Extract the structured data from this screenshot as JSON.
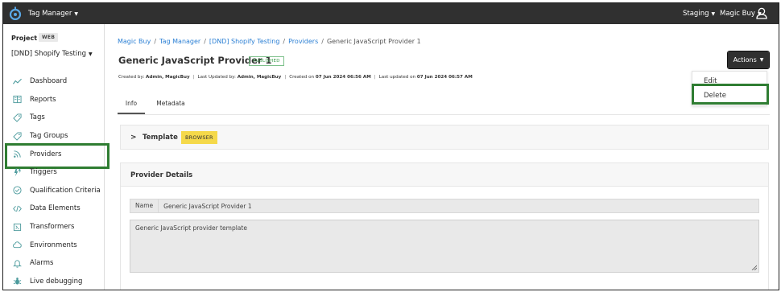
{
  "app": {
    "name": "Tag Manager",
    "env_menu": "Staging",
    "account_menu": "Magic Buy"
  },
  "sidebar": {
    "project_label": "Project",
    "project_badge": "WEB",
    "project_name": "[DND] Shopify Testing",
    "items": [
      {
        "label": "Dashboard",
        "icon": "dashboard-icon"
      },
      {
        "label": "Reports",
        "icon": "reports-icon"
      },
      {
        "label": "Tags",
        "icon": "tag-icon"
      },
      {
        "label": "Tag Groups",
        "icon": "tag-groups-icon"
      },
      {
        "label": "Providers",
        "icon": "providers-icon",
        "highlighted": true
      },
      {
        "label": "Triggers",
        "icon": "lightning-icon"
      },
      {
        "label": "Qualification Criteria",
        "icon": "check-circle-icon"
      },
      {
        "label": "Data Elements",
        "icon": "code-icon"
      },
      {
        "label": "Transformers",
        "icon": "transformer-icon"
      },
      {
        "label": "Environments",
        "icon": "cloud-icon"
      },
      {
        "label": "Alarms",
        "icon": "bell-icon"
      },
      {
        "label": "Live debugging",
        "icon": "bug-icon"
      }
    ]
  },
  "breadcrumb": [
    "Magic Buy",
    "Tag Manager",
    "[DND] Shopify Testing",
    "Providers",
    "Generic JavaScript Provider 1"
  ],
  "page": {
    "title": "Generic JavaScript Provider 1",
    "status": "PUBLISHED",
    "meta": {
      "created_by_label": "Created by",
      "created_by": "Admin, MagicBuy",
      "updated_by_label": "Last Updated by",
      "updated_by": "Admin, MagicBuy",
      "created_on_label": "Created on",
      "created_on": "07 Jun 2024 06:56 AM",
      "updated_on_label": "Last updated on",
      "updated_on": "07 Jun 2024 06:57 AM"
    }
  },
  "actions": {
    "label": "Actions",
    "menu": [
      "Edit",
      "Delete"
    ],
    "highlighted_item": "Delete"
  },
  "tabs": [
    "Info",
    "Metadata"
  ],
  "template_panel": {
    "title": "Template",
    "badge": "BROWSER"
  },
  "details_panel": {
    "title": "Provider Details",
    "name_label": "Name",
    "name_value": "Generic JavaScript Provider 1",
    "description": "Generic JavaScript provider template"
  },
  "colors": {
    "topbar": "#303030",
    "link": "#2a7fd4",
    "highlight": "#2f7d32",
    "badge_yellow": "#f5d94a",
    "icon_teal": "#4b9a9c"
  }
}
